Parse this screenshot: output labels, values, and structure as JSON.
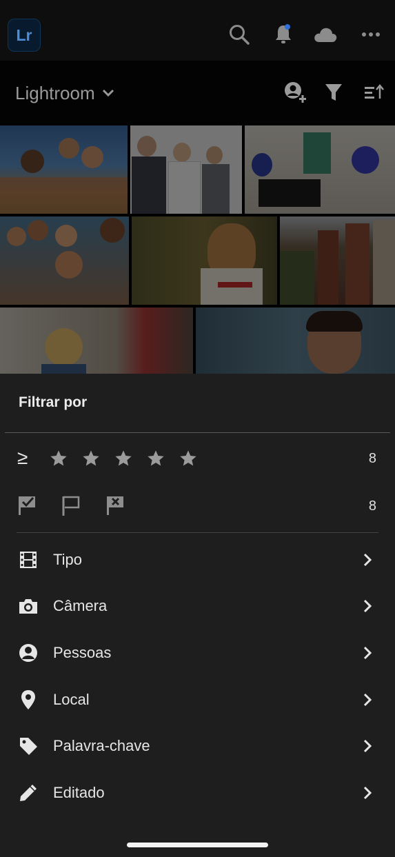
{
  "app": {
    "logo_text": "Lr"
  },
  "topbar": {
    "icons": [
      "search-icon",
      "bell-icon",
      "cloud-icon",
      "more-icon"
    ],
    "notification_dot_color": "#2f70d8"
  },
  "header": {
    "album_title": "Lightroom",
    "icons": [
      "add-person-icon",
      "filter-icon",
      "sort-icon"
    ]
  },
  "grid": {
    "photos": [
      "friends-at-beach-photo",
      "business-team-photo",
      "office-meeting-photo",
      "group-selfie-photo",
      "dog-photo",
      "houses-row-photo",
      "child-kitchen-photo",
      "man-portrait-photo"
    ]
  },
  "filter_sheet": {
    "title": "Filtrar por",
    "rating": {
      "operator": "≥",
      "stars_total": 5,
      "stars_selected": 0,
      "count": "8"
    },
    "flags": {
      "icons": [
        "picked-flag-icon",
        "unflagged-icon",
        "rejected-flag-icon"
      ],
      "count": "8"
    },
    "items": [
      {
        "label": "Tipo",
        "icon": "film-icon"
      },
      {
        "label": "Câmera",
        "icon": "camera-icon"
      },
      {
        "label": "Pessoas",
        "icon": "person-icon"
      },
      {
        "label": "Local",
        "icon": "location-pin-icon"
      },
      {
        "label": "Palavra-chave",
        "icon": "tag-icon"
      },
      {
        "label": "Editado",
        "icon": "pencil-icon"
      }
    ]
  },
  "colors": {
    "sheet_bg": "#1e1e1e",
    "topbar_bg": "#0e0e0e",
    "accent": "#2f70d8"
  }
}
